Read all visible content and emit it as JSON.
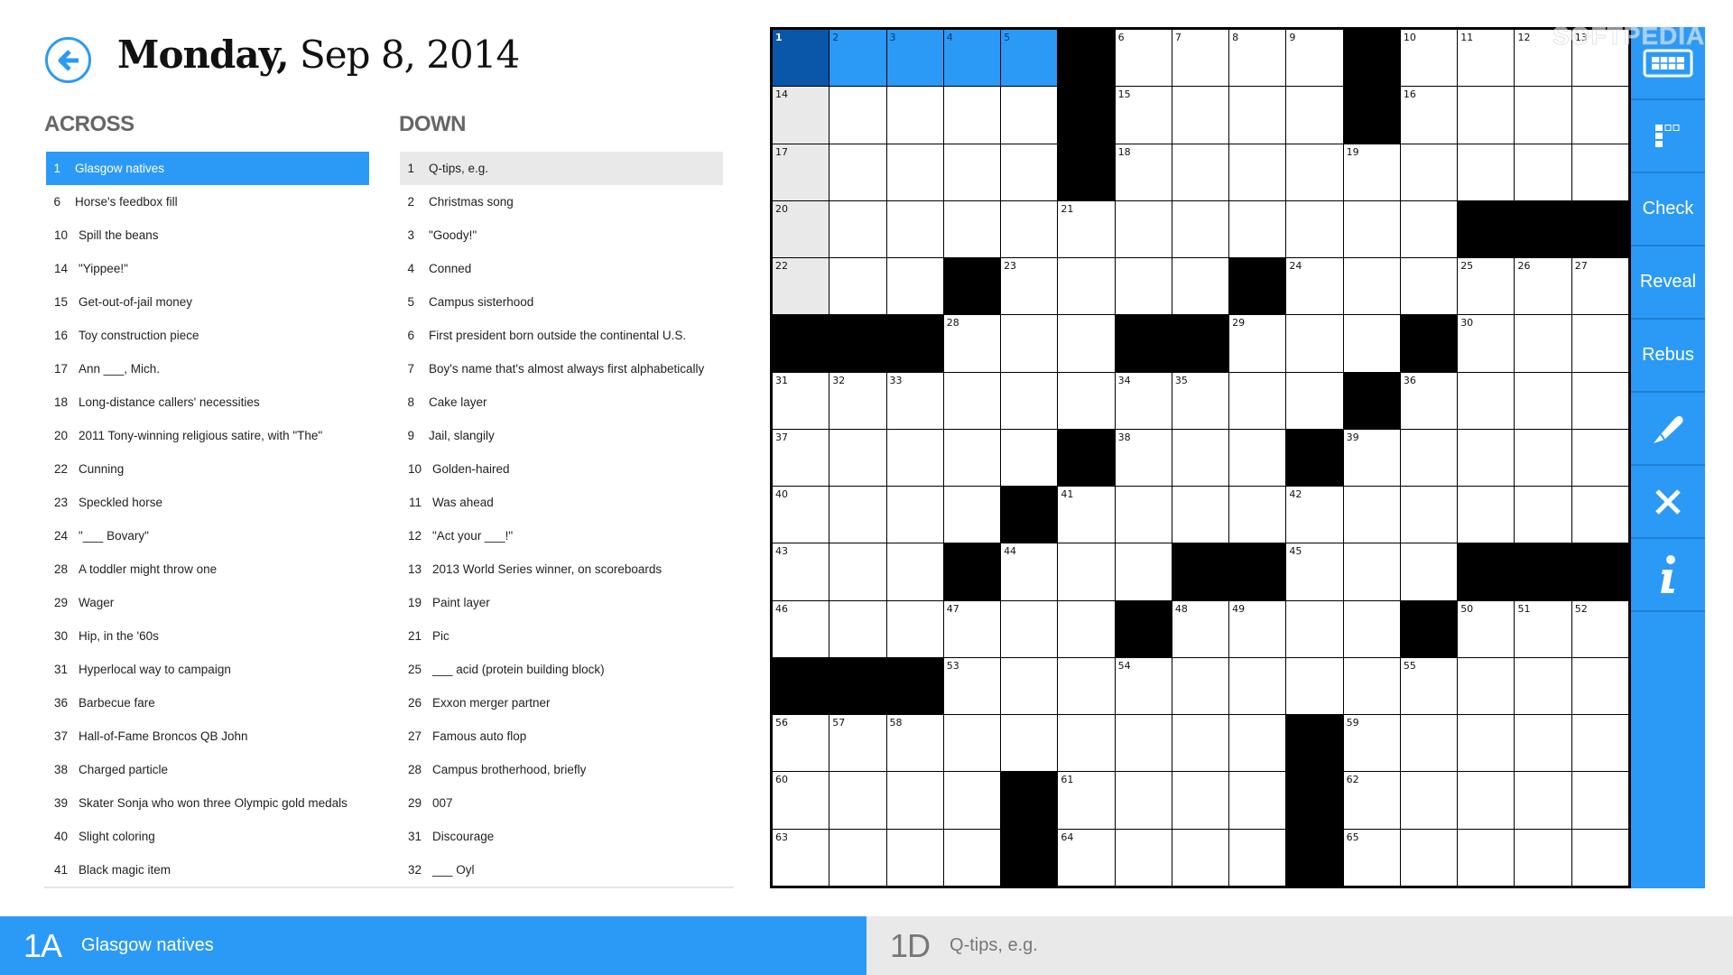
{
  "header": {
    "weekday": "Monday,",
    "date": "Sep 8, 2014"
  },
  "across": {
    "title": "ACROSS",
    "clues": [
      {
        "n": "1",
        "t": "Glasgow natives"
      },
      {
        "n": "6",
        "t": "Horse's feedbox fill"
      },
      {
        "n": "10",
        "t": "Spill the beans"
      },
      {
        "n": "14",
        "t": "\"Yippee!\""
      },
      {
        "n": "15",
        "t": "Get-out-of-jail money"
      },
      {
        "n": "16",
        "t": "Toy construction piece"
      },
      {
        "n": "17",
        "t": "Ann ___, Mich."
      },
      {
        "n": "18",
        "t": "Long-distance callers' necessities"
      },
      {
        "n": "20",
        "t": "2011 Tony-winning religious satire, with \"The\""
      },
      {
        "n": "22",
        "t": "Cunning"
      },
      {
        "n": "23",
        "t": "Speckled horse"
      },
      {
        "n": "24",
        "t": "\"___ Bovary\""
      },
      {
        "n": "28",
        "t": "A toddler might throw one"
      },
      {
        "n": "29",
        "t": "Wager"
      },
      {
        "n": "30",
        "t": "Hip, in the '60s"
      },
      {
        "n": "31",
        "t": "Hyperlocal way to campaign"
      },
      {
        "n": "36",
        "t": "Barbecue fare"
      },
      {
        "n": "37",
        "t": "Hall-of-Fame Broncos QB John"
      },
      {
        "n": "38",
        "t": "Charged particle"
      },
      {
        "n": "39",
        "t": "Skater Sonja who won three Olympic gold medals"
      },
      {
        "n": "40",
        "t": "Slight coloring"
      },
      {
        "n": "41",
        "t": "Black magic item"
      }
    ]
  },
  "down": {
    "title": "DOWN",
    "clues": [
      {
        "n": "1",
        "t": "Q-tips, e.g."
      },
      {
        "n": "2",
        "t": "Christmas song"
      },
      {
        "n": "3",
        "t": "\"Goody!\""
      },
      {
        "n": "4",
        "t": "Conned"
      },
      {
        "n": "5",
        "t": "Campus sisterhood"
      },
      {
        "n": "6",
        "t": "First president born outside the continental U.S."
      },
      {
        "n": "7",
        "t": "Boy's name that's almost always first alphabetically"
      },
      {
        "n": "8",
        "t": "Cake layer"
      },
      {
        "n": "9",
        "t": "Jail, slangily"
      },
      {
        "n": "10",
        "t": "Golden-haired"
      },
      {
        "n": "11",
        "t": "Was ahead"
      },
      {
        "n": "12",
        "t": "\"Act your ___!\""
      },
      {
        "n": "13",
        "t": "2013 World Series winner, on scoreboards"
      },
      {
        "n": "19",
        "t": "Paint layer"
      },
      {
        "n": "21",
        "t": "Pic"
      },
      {
        "n": "25",
        "t": "___ acid (protein building block)"
      },
      {
        "n": "26",
        "t": "Exxon merger partner"
      },
      {
        "n": "27",
        "t": "Famous auto flop"
      },
      {
        "n": "28",
        "t": "Campus brotherhood, briefly"
      },
      {
        "n": "29",
        "t": "007"
      },
      {
        "n": "31",
        "t": "Discourage"
      },
      {
        "n": "32",
        "t": "___ Oyl"
      }
    ]
  },
  "grid": {
    "rows": [
      ".....#....#....",
      ".....#....#....",
      ".....#.........",
      "............###",
      "...#....#......",
      "###...##...#...",
      "..........#....",
      ".....#...#.....",
      "....#..........",
      "...#...##...###",
      "......#....#...",
      "###............",
      ".........#.....",
      "....#....#.....",
      "....#....#....."
    ],
    "selected": {
      "row": 0,
      "col": 0,
      "direction": "across"
    }
  },
  "toolbar": {
    "check": "Check",
    "reveal": "Reveal",
    "rebus": "Rebus"
  },
  "bottom": {
    "across_label": "1A",
    "across_clue": "Glasgow natives",
    "down_label": "1D",
    "down_clue": "Q-tips, e.g."
  },
  "colors": {
    "accent": "#2b9af7",
    "current_cell": "#0a56a8",
    "crossing": "#e9e9e9"
  },
  "watermark": "SOFTPEDIA"
}
